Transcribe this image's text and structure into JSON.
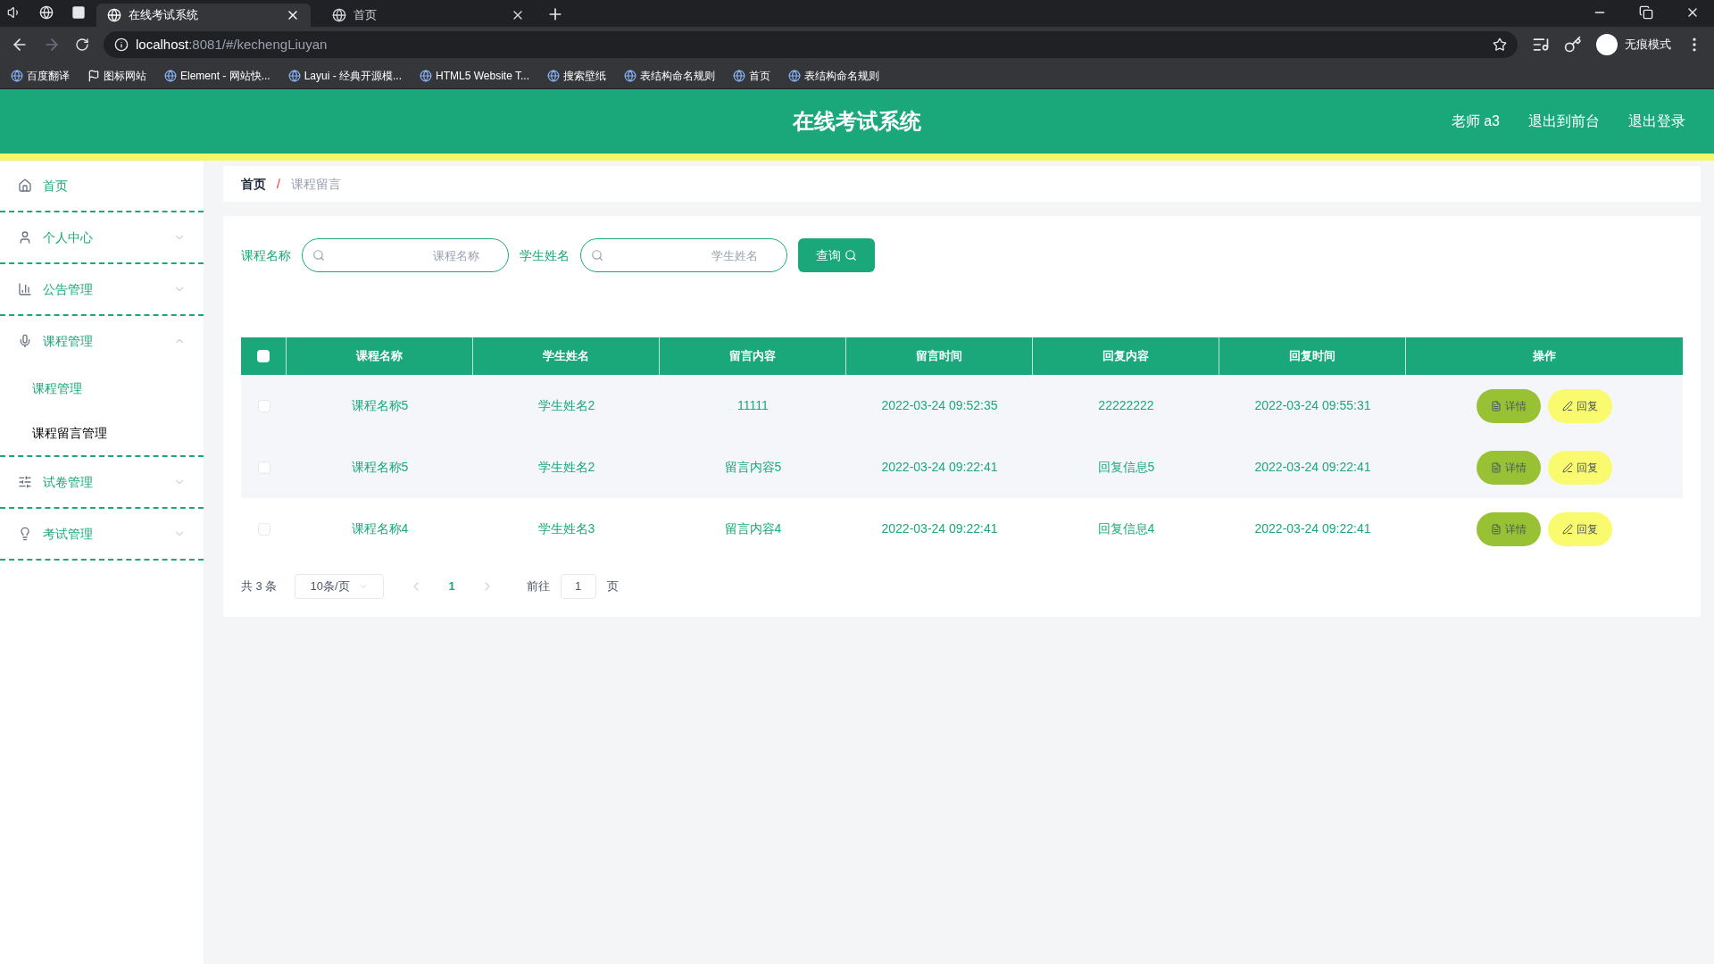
{
  "browser": {
    "tabs": [
      {
        "title": "在线考试系统",
        "selected": true
      },
      {
        "title": "首页",
        "selected": false
      }
    ],
    "url_host": "localhost",
    "url_rest": ":8081/#/kechengLiuyan",
    "profile": "无痕模式",
    "bookmarks": [
      "百度翻译",
      "图标网站",
      "Element - 网站快...",
      "Layui - 经典开源模...",
      "HTML5 Website T...",
      "搜索壁纸",
      "表结构命名规则",
      "首页",
      "表结构命名规则"
    ]
  },
  "header": {
    "title": "在线考试系统",
    "links": [
      "老师 a3",
      "退出到前台",
      "退出登录"
    ]
  },
  "sidebar": {
    "items": [
      {
        "label": "首页",
        "kind": "link"
      },
      {
        "label": "个人中心",
        "kind": "group",
        "expanded": false
      },
      {
        "label": "公告管理",
        "kind": "group",
        "expanded": false
      },
      {
        "label": "课程管理",
        "kind": "group",
        "expanded": true,
        "children": [
          {
            "label": "课程管理",
            "selected": false
          },
          {
            "label": "课程留言管理",
            "selected": true
          }
        ]
      },
      {
        "label": "试卷管理",
        "kind": "group",
        "expanded": false
      },
      {
        "label": "考试管理",
        "kind": "group",
        "expanded": false
      }
    ]
  },
  "breadcrumb": {
    "items": [
      "首页",
      "课程留言"
    ],
    "separator": "/"
  },
  "search": {
    "fields": [
      {
        "label": "课程名称",
        "placeholder": "课程名称"
      },
      {
        "label": "学生姓名",
        "placeholder": "学生姓名"
      }
    ],
    "button": "查询"
  },
  "table": {
    "select_all_checked": false,
    "columns": [
      "课程名称",
      "学生姓名",
      "留言内容",
      "留言时间",
      "回复内容",
      "回复时间",
      "操作"
    ],
    "rows": [
      {
        "checked": false,
        "cells": [
          "课程名称5",
          "学生姓名2",
          "11111",
          "2022-03-24 09:52:35",
          "22222222",
          "2022-03-24 09:55:31"
        ],
        "actions": [
          "详情",
          "回复"
        ]
      },
      {
        "checked": false,
        "cells": [
          "课程名称5",
          "学生姓名2",
          "留言内容5",
          "2022-03-24 09:22:41",
          "回复信息5",
          "2022-03-24 09:22:41"
        ],
        "actions": [
          "详情",
          "回复"
        ]
      },
      {
        "checked": false,
        "cells": [
          "课程名称4",
          "学生姓名3",
          "留言内容4",
          "2022-03-24 09:22:41",
          "回复信息4",
          "2022-03-24 09:22:41"
        ],
        "actions": [
          "详情",
          "回复"
        ]
      }
    ]
  },
  "pagination": {
    "total": "共 3 条",
    "page_size": "10条/页",
    "pages": [
      {
        "label": "1",
        "selected": true
      }
    ],
    "goto_label": "前往",
    "goto_value": "1",
    "goto_suffix": "页"
  }
}
